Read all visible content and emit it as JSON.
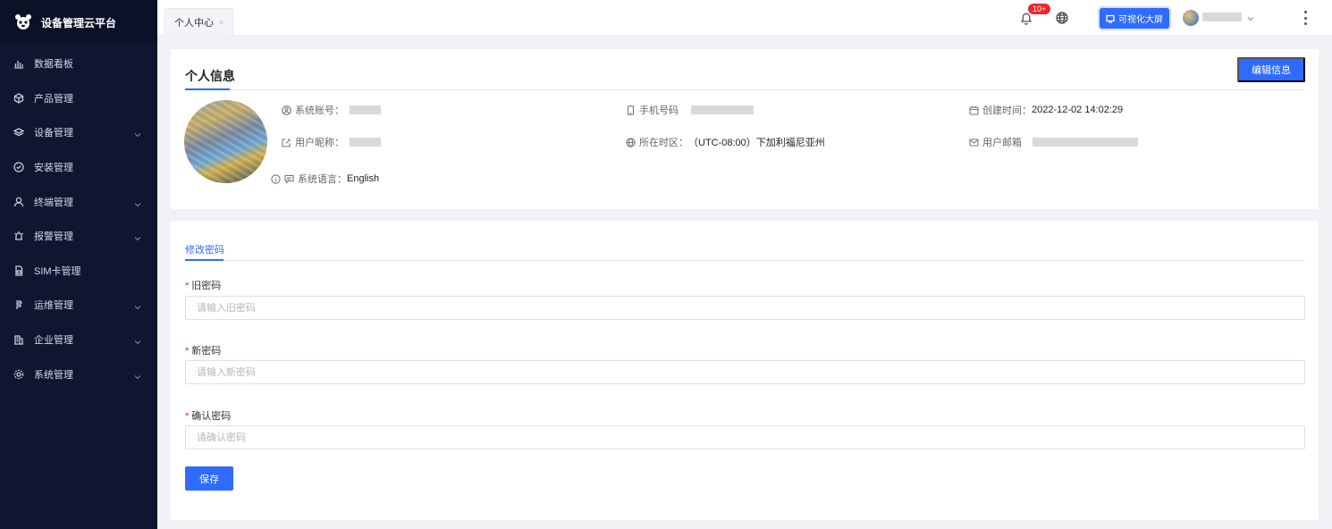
{
  "brand": {
    "title": "设备管理云平台",
    "logo_icon": "panda-logo-icon"
  },
  "sidebar": {
    "items": [
      {
        "label": "数据看板",
        "icon": "bar-chart-icon",
        "has_children": false
      },
      {
        "label": "产品管理",
        "icon": "cube-icon",
        "has_children": false
      },
      {
        "label": "设备管理",
        "icon": "layers-icon",
        "has_children": true
      },
      {
        "label": "安装管理",
        "icon": "shield-check-icon",
        "has_children": false
      },
      {
        "label": "终端管理",
        "icon": "user-icon",
        "has_children": true
      },
      {
        "label": "报警管理",
        "icon": "alarm-icon",
        "has_children": true
      },
      {
        "label": "SIM卡管理",
        "icon": "sim-card-icon",
        "has_children": false
      },
      {
        "label": "运维管理",
        "icon": "ops-icon",
        "has_children": true
      },
      {
        "label": "企业管理",
        "icon": "building-icon",
        "has_children": true
      },
      {
        "label": "系统管理",
        "icon": "gear-icon",
        "has_children": true
      }
    ]
  },
  "topbar": {
    "tab_label": "个人中心",
    "tab_close": "×",
    "notification_badge": "10+",
    "visual_screen_label": "可视化大屏"
  },
  "profile": {
    "section_title": "个人信息",
    "edit_button": "编辑信息",
    "account_label": "系统账号：",
    "phone_label": "手机号码",
    "created_label": "创建时间：",
    "created_value": "2022-12-02 14:02:29",
    "nickname_label": "用户昵称：",
    "timezone_label": "所在时区：",
    "timezone_value": "（UTC-08:00）下加利福尼亚州",
    "email_label": "用户邮箱",
    "language_label": "系统语言：",
    "language_value": "English"
  },
  "password_form": {
    "tab_label": "修改密码",
    "required_mark": "*",
    "old_label": "旧密码",
    "old_placeholder": "请输入旧密码",
    "new_label": "新密码",
    "new_placeholder": "请输入新密码",
    "confirm_label": "确认密码",
    "confirm_placeholder": "请确认密码",
    "save_button": "保存"
  },
  "colors": {
    "sidebar_bg": "#0e1630",
    "primary": "#2f6bff",
    "badge": "#f5222d"
  }
}
